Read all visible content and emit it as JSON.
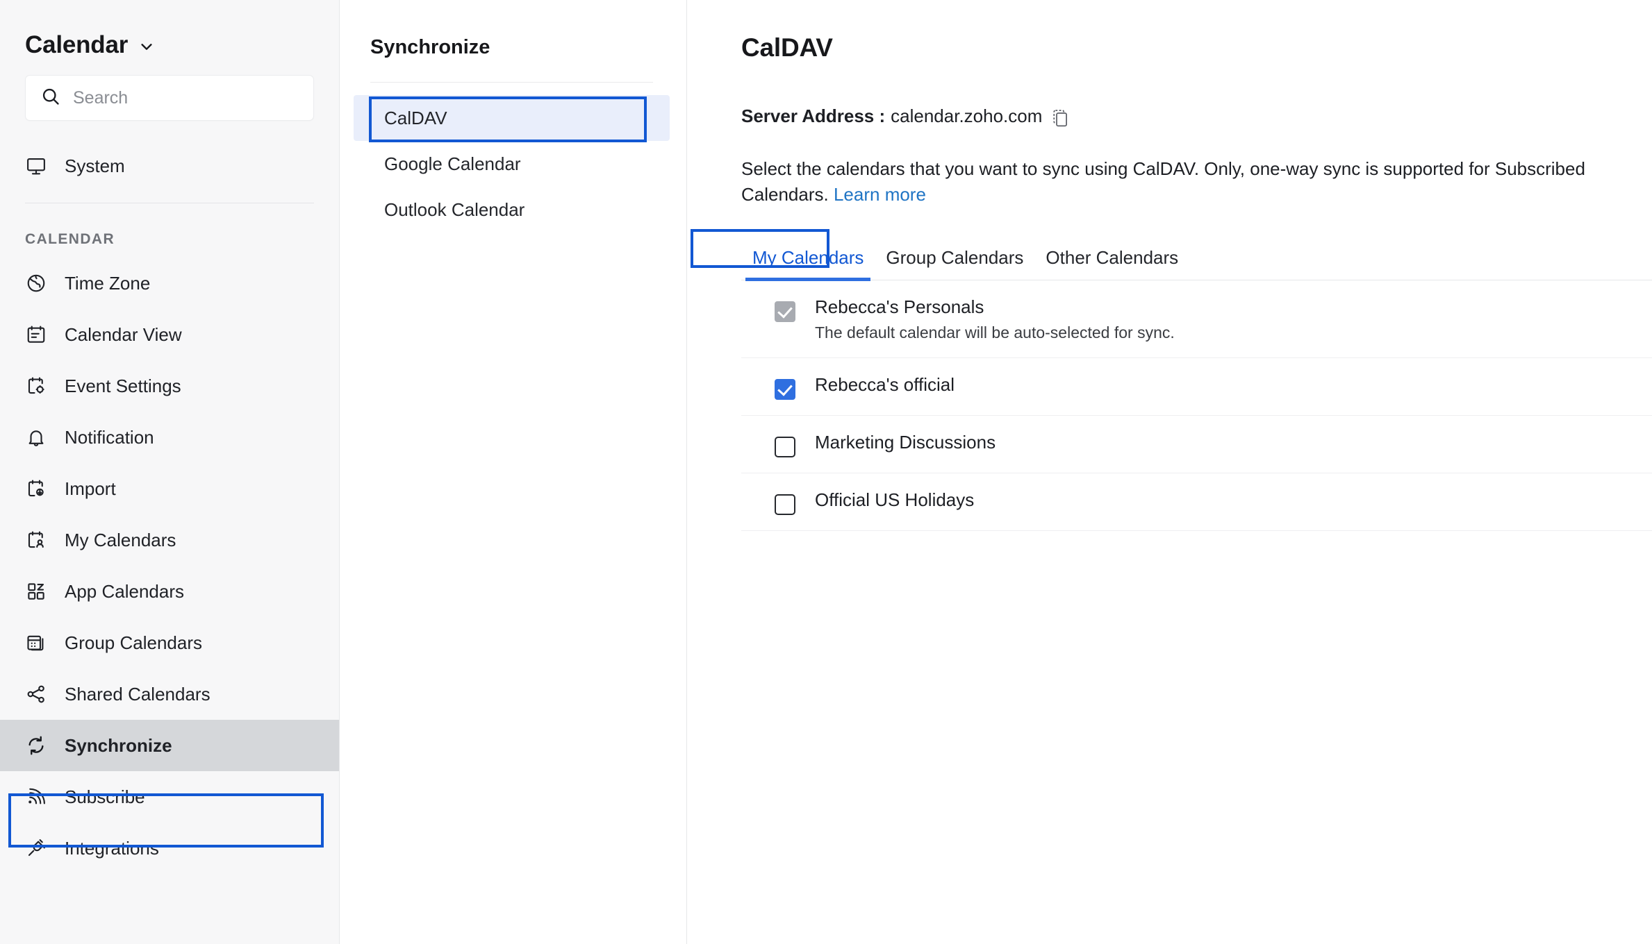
{
  "sidebar": {
    "brand_title": "Calendar",
    "search_placeholder": "Search",
    "top_items": [
      {
        "label": "System",
        "icon": "monitor-icon"
      }
    ],
    "section_label": "CALENDAR",
    "items": [
      {
        "label": "Time Zone",
        "icon": "globe-icon",
        "selected": false
      },
      {
        "label": "Calendar View",
        "icon": "calendar-lines-icon",
        "selected": false
      },
      {
        "label": "Event Settings",
        "icon": "calendar-gear-icon",
        "selected": false
      },
      {
        "label": "Notification",
        "icon": "bell-icon",
        "selected": false
      },
      {
        "label": "Import",
        "icon": "calendar-download-icon",
        "selected": false
      },
      {
        "label": "My Calendars",
        "icon": "calendar-user-icon",
        "selected": false
      },
      {
        "label": "App Calendars",
        "icon": "app-grid-icon",
        "selected": false
      },
      {
        "label": "Group Calendars",
        "icon": "calendar-stack-icon",
        "selected": false
      },
      {
        "label": "Shared Calendars",
        "icon": "share-nodes-icon",
        "selected": false
      },
      {
        "label": "Synchronize",
        "icon": "sync-refresh-icon",
        "selected": true
      },
      {
        "label": "Subscribe",
        "icon": "rss-feed-icon",
        "selected": false
      },
      {
        "label": "Integrations",
        "icon": "plug-icon",
        "selected": false
      }
    ]
  },
  "midcol": {
    "title": "Synchronize",
    "items": [
      {
        "label": "CalDAV",
        "active": true
      },
      {
        "label": "Google Calendar",
        "active": false
      },
      {
        "label": "Outlook Calendar",
        "active": false
      }
    ]
  },
  "main": {
    "title": "CalDAV",
    "server_label": "Server Address :",
    "server_value": "calendar.zoho.com",
    "copy_icon": "copy-icon",
    "description": "Select the calendars that you want to sync using CalDAV. Only, one-way sync is supported for Subscribed Calendars.",
    "learn_more": "Learn more",
    "tabs": [
      {
        "label": "My Calendars",
        "active": true
      },
      {
        "label": "Group Calendars",
        "active": false
      },
      {
        "label": "Other Calendars",
        "active": false
      }
    ],
    "calendars": [
      {
        "name": "Rebecca's Personals",
        "sub": "The default calendar will be auto-selected for sync.",
        "state": "disabled"
      },
      {
        "name": "Rebecca's official",
        "sub": "",
        "state": "checked"
      },
      {
        "name": "Marketing Discussions",
        "sub": "",
        "state": "unchecked"
      },
      {
        "name": "Official US Holidays",
        "sub": "",
        "state": "unchecked"
      }
    ]
  },
  "colors": {
    "annotation_blue": "#1258d3",
    "accent_blue": "#2f6fe0",
    "link_blue": "#1f74c4",
    "selected_item_bg": "#d5d7da",
    "active_mid_bg": "#e9eefb"
  }
}
